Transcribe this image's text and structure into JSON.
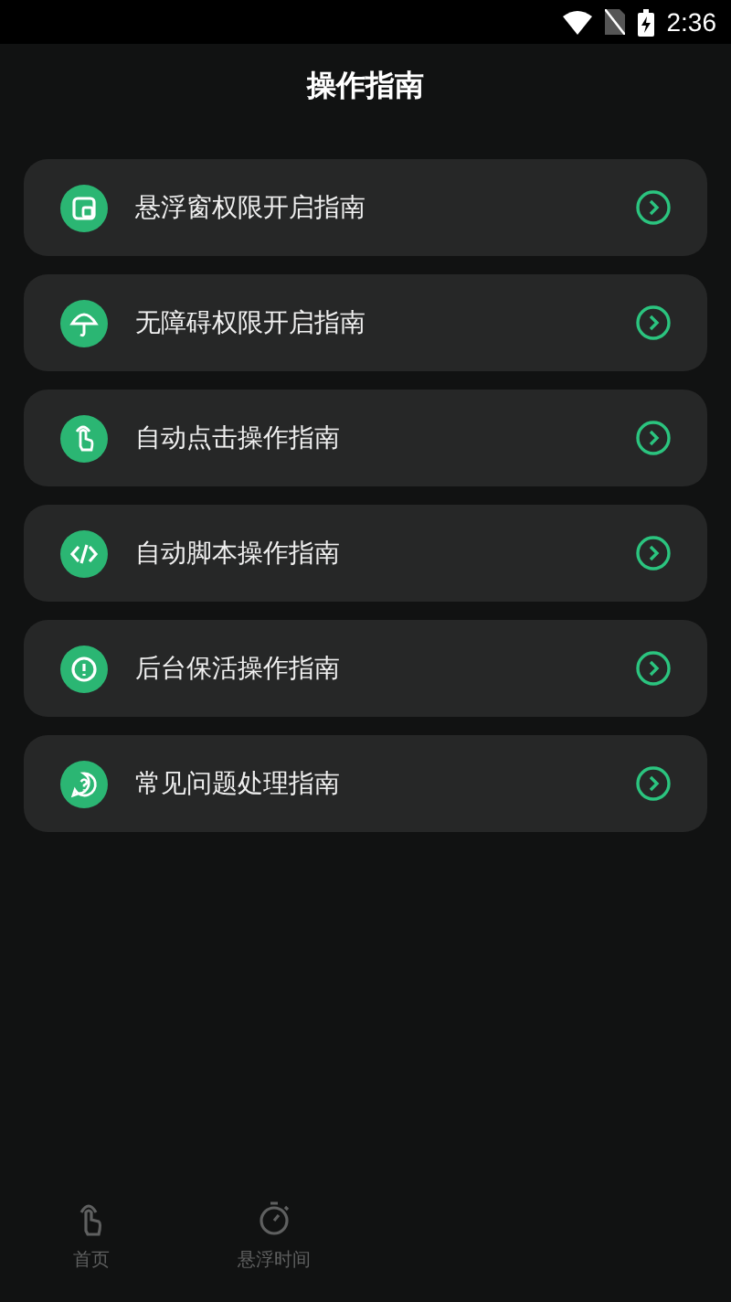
{
  "status_bar": {
    "time": "2:36"
  },
  "header": {
    "title": "操作指南"
  },
  "guides": [
    {
      "kind": "window",
      "label": "悬浮窗权限开启指南"
    },
    {
      "kind": "umbrella",
      "label": "无障碍权限开启指南"
    },
    {
      "kind": "tap",
      "label": "自动点击操作指南"
    },
    {
      "kind": "code",
      "label": "自动脚本操作指南"
    },
    {
      "kind": "alert",
      "label": "后台保活操作指南"
    },
    {
      "kind": "help",
      "label": "常见问题处理指南"
    }
  ],
  "bottom_nav": [
    {
      "kind": "tap",
      "label": "首页",
      "selected": false
    },
    {
      "kind": "timer",
      "label": "悬浮时间",
      "selected": false
    }
  ]
}
